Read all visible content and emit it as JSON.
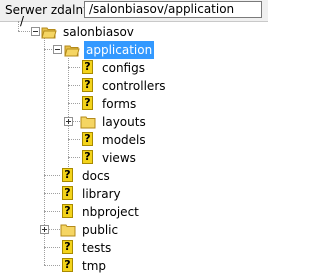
{
  "header": {
    "label": "Serwer zdalny:",
    "path": "/salonbiasov/application"
  },
  "tree": {
    "root": "/",
    "salonbiasov": "salonbiasov",
    "application": "application",
    "app_children": {
      "configs": "configs",
      "controllers": "controllers",
      "forms": "forms",
      "layouts": "layouts",
      "models": "models",
      "views": "views"
    },
    "salon_children": {
      "docs": "docs",
      "library": "library",
      "nbproject": "nbproject",
      "public": "public",
      "tests": "tests",
      "tmp": "tmp"
    }
  },
  "icons": {
    "folder": "folder-icon",
    "unknown": "question-mark-icon"
  },
  "colors": {
    "selection": "#3399ff",
    "folder": "#f5d563"
  }
}
